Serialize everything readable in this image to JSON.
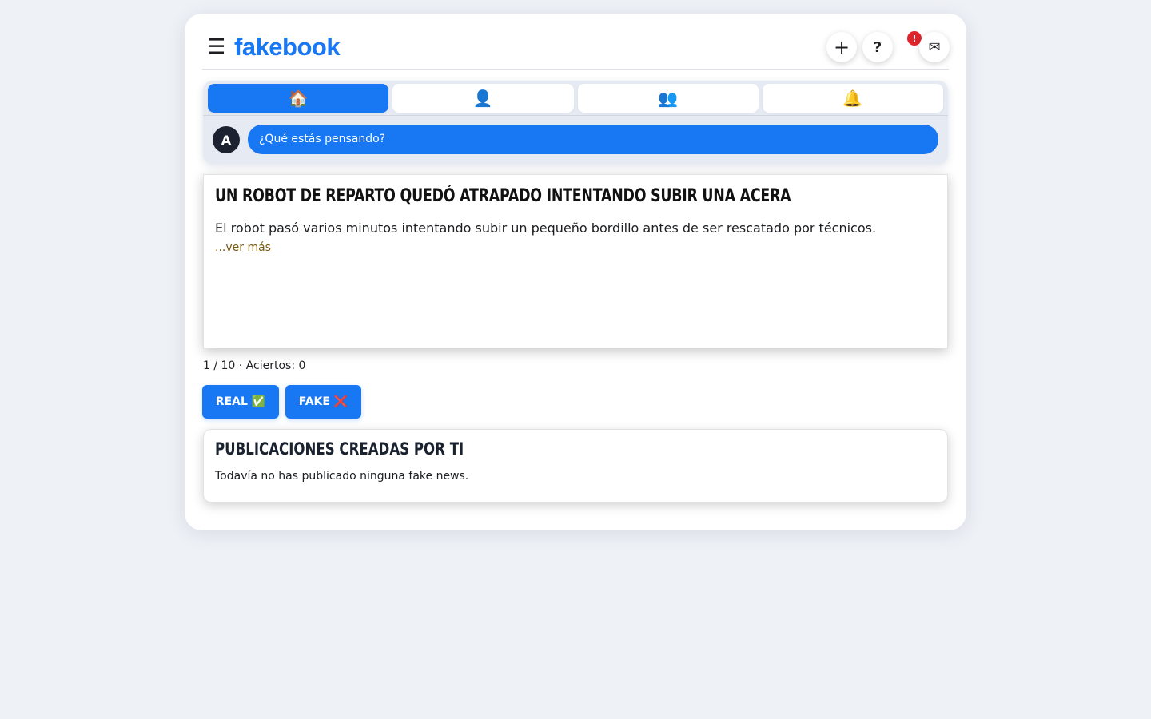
{
  "header": {
    "menu_icon": "☰",
    "logo": "fakebook",
    "plus_label": "+",
    "help_label": "?",
    "help_badge": "!",
    "mail_icon": "✉"
  },
  "composer": {
    "tabs": [
      {
        "icon": "🏠",
        "name": "home-icon",
        "active": true
      },
      {
        "icon": "👤",
        "name": "profile-icon",
        "active": false
      },
      {
        "icon": "👥",
        "name": "friends-icon",
        "active": false
      },
      {
        "icon": "🔔",
        "name": "bell-icon",
        "active": false
      }
    ],
    "avatar_initial": "A",
    "placeholder": "¿Qué estás pensando?"
  },
  "post": {
    "title": "UN ROBOT DE REPARTO QUEDÓ ATRAPADO INTENTANDO SUBIR UNA ACERA",
    "body": "El robot pasó varios minutos intentando subir un pequeño bordillo antes de ser rescatado por técnicos.",
    "see_more": "...ver más"
  },
  "quiz": {
    "counter": "1 / 10 · Aciertos: 0",
    "real_label": "REAL ✅",
    "fake_label": "FAKE ❌"
  },
  "my_posts": {
    "title": "PUBLICACIONES CREADAS POR TI",
    "empty_text": "Todavía no has publicado ninguna fake news."
  },
  "colors": {
    "accent": "#1877f2",
    "background": "#eef1f6",
    "badge": "#e0242b"
  }
}
